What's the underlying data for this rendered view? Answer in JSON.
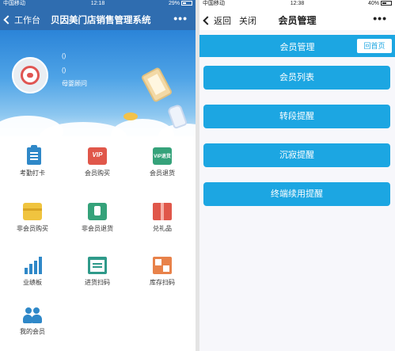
{
  "left": {
    "status": {
      "carrier": "中国移动",
      "time": "12:18",
      "battery": "29%"
    },
    "nav": {
      "back_label": "工作台",
      "title": "贝因美门店销售管理系统",
      "more": "•••"
    },
    "profile": {
      "line1": "()",
      "line2": "()",
      "role": "母婴顾问"
    },
    "grid": [
      {
        "label": "考勤打卡",
        "icon": "clipboard-icon"
      },
      {
        "label": "会员购买",
        "icon": "vip-card-icon"
      },
      {
        "label": "会员退货",
        "icon": "vip-return-icon"
      },
      {
        "label": "非会员购买",
        "icon": "card-icon"
      },
      {
        "label": "非会员退货",
        "icon": "return-icon"
      },
      {
        "label": "兑礼品",
        "icon": "gift-icon"
      },
      {
        "label": "业绩板",
        "icon": "bar-chart-icon"
      },
      {
        "label": "进货扫码",
        "icon": "cart-scan-icon"
      },
      {
        "label": "库存扫码",
        "icon": "qr-scan-icon"
      },
      {
        "label": "我的会员",
        "icon": "members-icon"
      }
    ],
    "icon_text": {
      "vip": "VIP",
      "vip_return": "VIP退货"
    }
  },
  "right": {
    "status": {
      "carrier": "中国移动",
      "time": "12:38",
      "battery": "40%"
    },
    "nav": {
      "back_label": "返回",
      "close_label": "关闭",
      "title": "会员管理",
      "more": "•••"
    },
    "subheader": {
      "title": "会员管理",
      "home_button": "回首页"
    },
    "menu": [
      {
        "label": "会员列表"
      },
      {
        "label": "转段提醒"
      },
      {
        "label": "沉寂提醒"
      },
      {
        "label": "终端续用提醒"
      }
    ]
  },
  "colors": {
    "left_nav": "#2f6db0",
    "accent": "#1ca6e2",
    "panel_bg": "#f7f7fb"
  }
}
